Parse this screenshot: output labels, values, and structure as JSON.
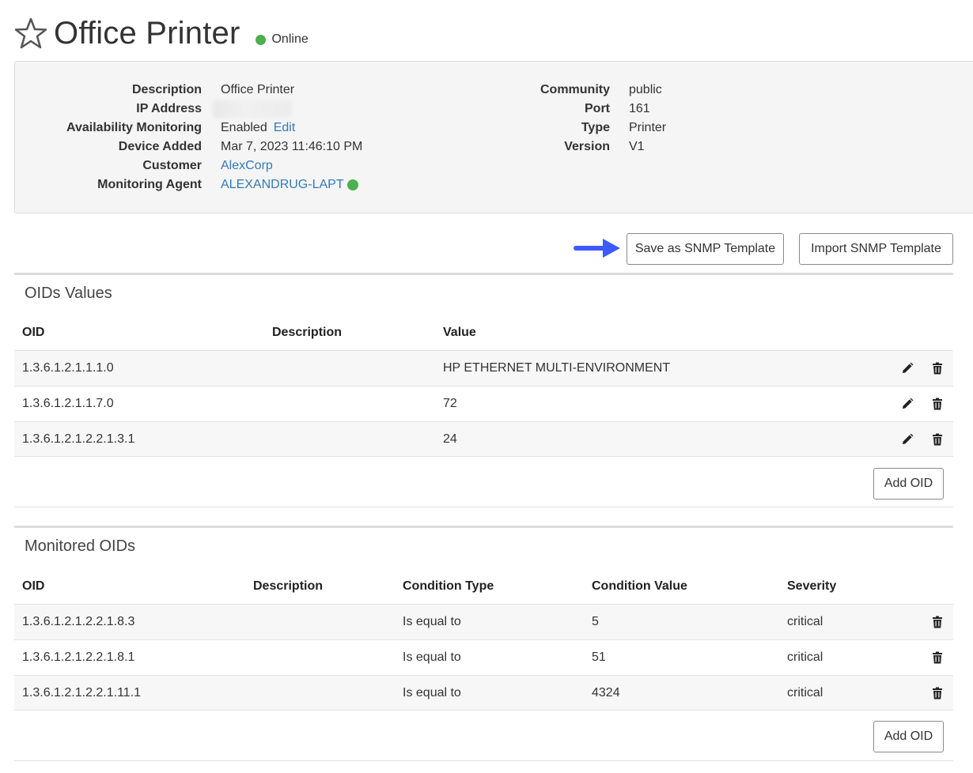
{
  "header": {
    "title": "Office Printer",
    "status": "Online",
    "status_color": "#4caf50",
    "favorite_icon": "star-outline-icon"
  },
  "details": {
    "left": [
      {
        "label": "Description",
        "value": "Office Printer"
      },
      {
        "label": "IP Address",
        "value": ""
      },
      {
        "label": "Availability Monitoring",
        "value": "Enabled",
        "link": "Edit"
      },
      {
        "label": "Device Added",
        "value": "Mar 7, 2023 11:46:10 PM"
      },
      {
        "label": "Customer",
        "value": "AlexCorp"
      },
      {
        "label": "Monitoring Agent",
        "value": "ALEXANDRUG-LAPT"
      }
    ],
    "right": [
      {
        "label": "Community",
        "value": "public"
      },
      {
        "label": "Port",
        "value": "161"
      },
      {
        "label": "Type",
        "value": "Printer"
      },
      {
        "label": "Version",
        "value": "V1"
      }
    ]
  },
  "actions": {
    "save_template": "Save as SNMP Template",
    "import_template": "Import SNMP Template",
    "arrow_color": "#3d5afe"
  },
  "oid_values": {
    "title": "OIDs Values",
    "columns": [
      "OID",
      "Description",
      "Value"
    ],
    "rows": [
      {
        "oid": "1.3.6.1.2.1.1.1.0",
        "description": "",
        "value": "HP ETHERNET MULTI-ENVIRONMENT"
      },
      {
        "oid": "1.3.6.1.2.1.1.7.0",
        "description": "",
        "value": "72"
      },
      {
        "oid": "1.3.6.1.2.1.2.2.1.3.1",
        "description": "",
        "value": "24"
      }
    ],
    "add_label": "Add OID"
  },
  "monitored_oids": {
    "title": "Monitored OIDs",
    "columns": [
      "OID",
      "Description",
      "Condition Type",
      "Condition Value",
      "Severity"
    ],
    "rows": [
      {
        "oid": "1.3.6.1.2.1.2.2.1.8.3",
        "description": "",
        "condition_type": "Is equal to",
        "condition_value": "5",
        "severity": "critical"
      },
      {
        "oid": "1.3.6.1.2.1.2.2.1.8.1",
        "description": "",
        "condition_type": "Is equal to",
        "condition_value": "51",
        "severity": "critical"
      },
      {
        "oid": "1.3.6.1.2.1.2.2.1.11.1",
        "description": "",
        "condition_type": "Is equal to",
        "condition_value": "4324",
        "severity": "critical"
      }
    ],
    "add_label": "Add OID"
  }
}
